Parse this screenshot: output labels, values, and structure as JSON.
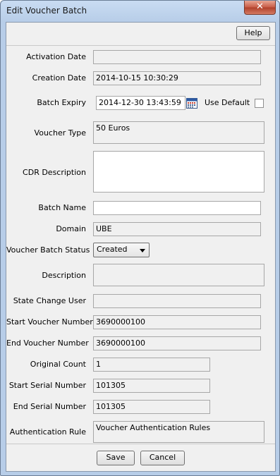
{
  "window": {
    "title": "Edit Voucher Batch",
    "close_glyph": "✕"
  },
  "toolbar": {
    "help_label": "Help"
  },
  "form": {
    "activation_date": {
      "label": "Activation Date",
      "value": ""
    },
    "creation_date": {
      "label": "Creation Date",
      "value": "2014-10-15 10:30:29"
    },
    "batch_expiry": {
      "label": "Batch Expiry",
      "value": "2014-12-30 13:43:59",
      "use_default_label": "Use Default",
      "use_default_checked": false
    },
    "voucher_type": {
      "label": "Voucher Type",
      "value": "50 Euros"
    },
    "cdr_description": {
      "label": "CDR Description",
      "value": ""
    },
    "batch_name": {
      "label": "Batch Name",
      "value": ""
    },
    "domain": {
      "label": "Domain",
      "value": "UBE"
    },
    "voucher_batch_status": {
      "label": "Voucher Batch Status",
      "value": "Created"
    },
    "description": {
      "label": "Description",
      "value": ""
    },
    "state_change_user": {
      "label": "State Change User",
      "value": ""
    },
    "start_voucher_number": {
      "label": "Start Voucher Number",
      "value": "3690000100"
    },
    "end_voucher_number": {
      "label": "End Voucher Number",
      "value": "3690000100"
    },
    "original_count": {
      "label": "Original Count",
      "value": "1"
    },
    "start_serial_number": {
      "label": "Start Serial Number",
      "value": "101305"
    },
    "end_serial_number": {
      "label": "End Serial Number",
      "value": "101305"
    },
    "authentication_rule": {
      "label": "Authentication Rule",
      "value": "Voucher Authentication Rules"
    }
  },
  "footer": {
    "save_label": "Save",
    "cancel_label": "Cancel"
  },
  "colors": {
    "title_bar": "#b7cde8",
    "close_button": "#c75b45",
    "client_bg": "#f0f0f0"
  }
}
